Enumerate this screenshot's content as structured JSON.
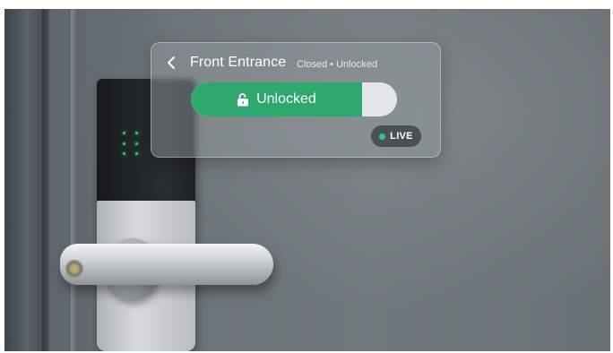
{
  "card": {
    "title": "Front Entrance",
    "status": {
      "door": "Closed",
      "separator": "•",
      "lock": "Unlocked"
    }
  },
  "slider": {
    "label": "Unlocked",
    "icon": "unlock-icon",
    "fill_fraction": 0.83,
    "fill_color": "#2fa86d",
    "track_color": "#e4e7e9"
  },
  "live_badge": {
    "label": "LIVE",
    "dot_color": "#38c57e"
  },
  "icons": {
    "back": "chevron-left-icon",
    "lock": "unlock-icon"
  },
  "colors": {
    "accent": "#2fa86d",
    "keypad_led": "#2fd07a"
  }
}
